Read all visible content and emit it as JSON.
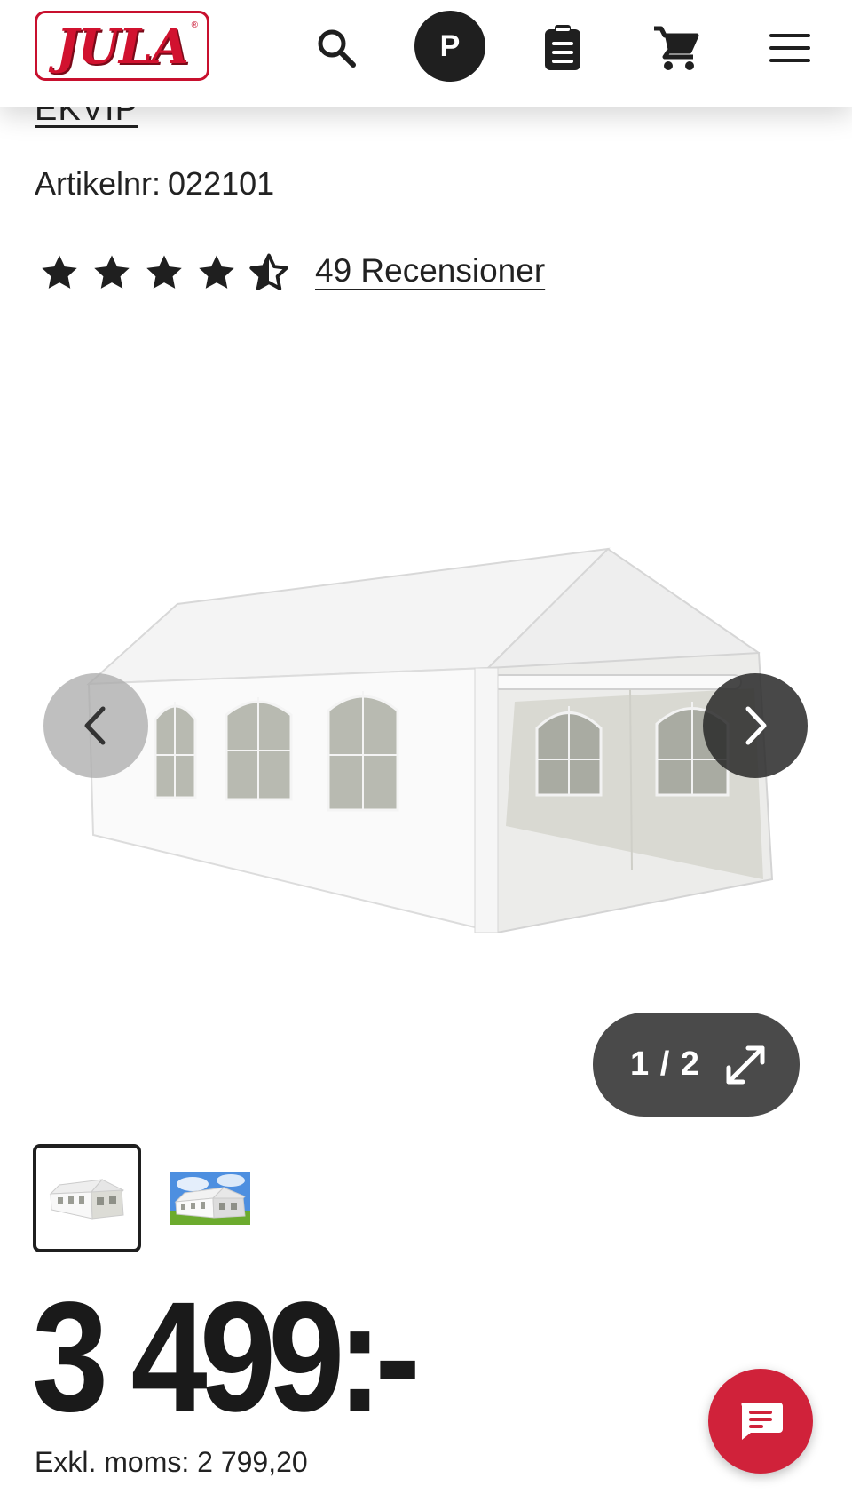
{
  "header": {
    "logo_text": "JULA",
    "logo_mark": "®",
    "profile_initial": "P",
    "icons": [
      "search-icon",
      "profile-icon",
      "shopping-list-icon",
      "cart-icon",
      "menu-icon"
    ]
  },
  "product": {
    "brand": "EKVIP",
    "article_label": "Artikelnr:",
    "article_number": "022101",
    "rating": 4.5,
    "rating_max": 5,
    "reviews_text": "49 Recensioner",
    "image_counter": "1 / 2",
    "thumbnails": [
      "tent-thumbnail-1",
      "tent-thumbnail-2"
    ],
    "price": "3 499:-",
    "exkl_moms_label": "Exkl. moms:",
    "exkl_moms_value": "2 799,20"
  },
  "colors": {
    "brand_red": "#d1122f",
    "chat_red": "#d0223a",
    "dark": "#1f1f1f"
  }
}
